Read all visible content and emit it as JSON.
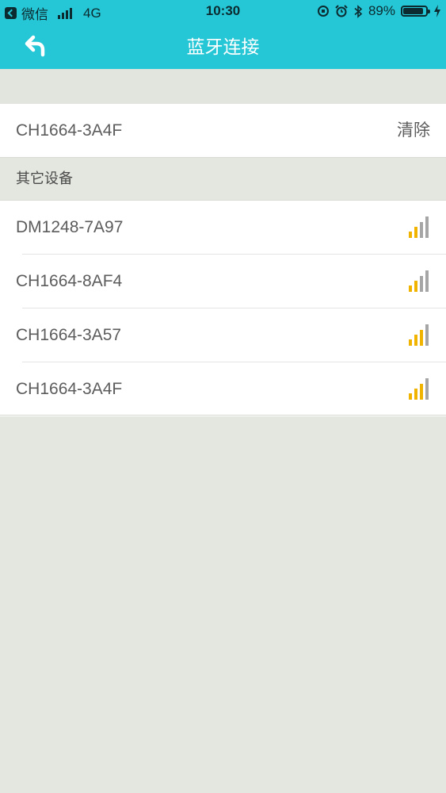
{
  "status_bar": {
    "carrier": "微信",
    "network": "4G",
    "time": "10:30",
    "battery_percent": "89%",
    "battery_level": 0.89
  },
  "nav": {
    "title": "蓝牙连接"
  },
  "connected_device": {
    "name": "CH1664-3A4F",
    "action_label": "清除"
  },
  "other_devices": {
    "header": "其它设备",
    "items": [
      {
        "name": "DM1248-7A97",
        "signal_bars": 2,
        "signal_icon": "signal-strength-icon"
      },
      {
        "name": "CH1664-8AF4",
        "signal_bars": 2,
        "signal_icon": "signal-strength-icon"
      },
      {
        "name": "CH1664-3A57",
        "signal_bars": 3,
        "signal_icon": "signal-strength-icon"
      },
      {
        "name": "CH1664-3A4F",
        "signal_bars": 3,
        "signal_icon": "signal-strength-icon"
      }
    ]
  },
  "colors": {
    "nav_bg": "#25c6d5",
    "page_bg": "#e3e7df",
    "signal_active": "#f0b400",
    "signal_inactive": "#a6a6a6",
    "text": "#5c5c5c"
  }
}
